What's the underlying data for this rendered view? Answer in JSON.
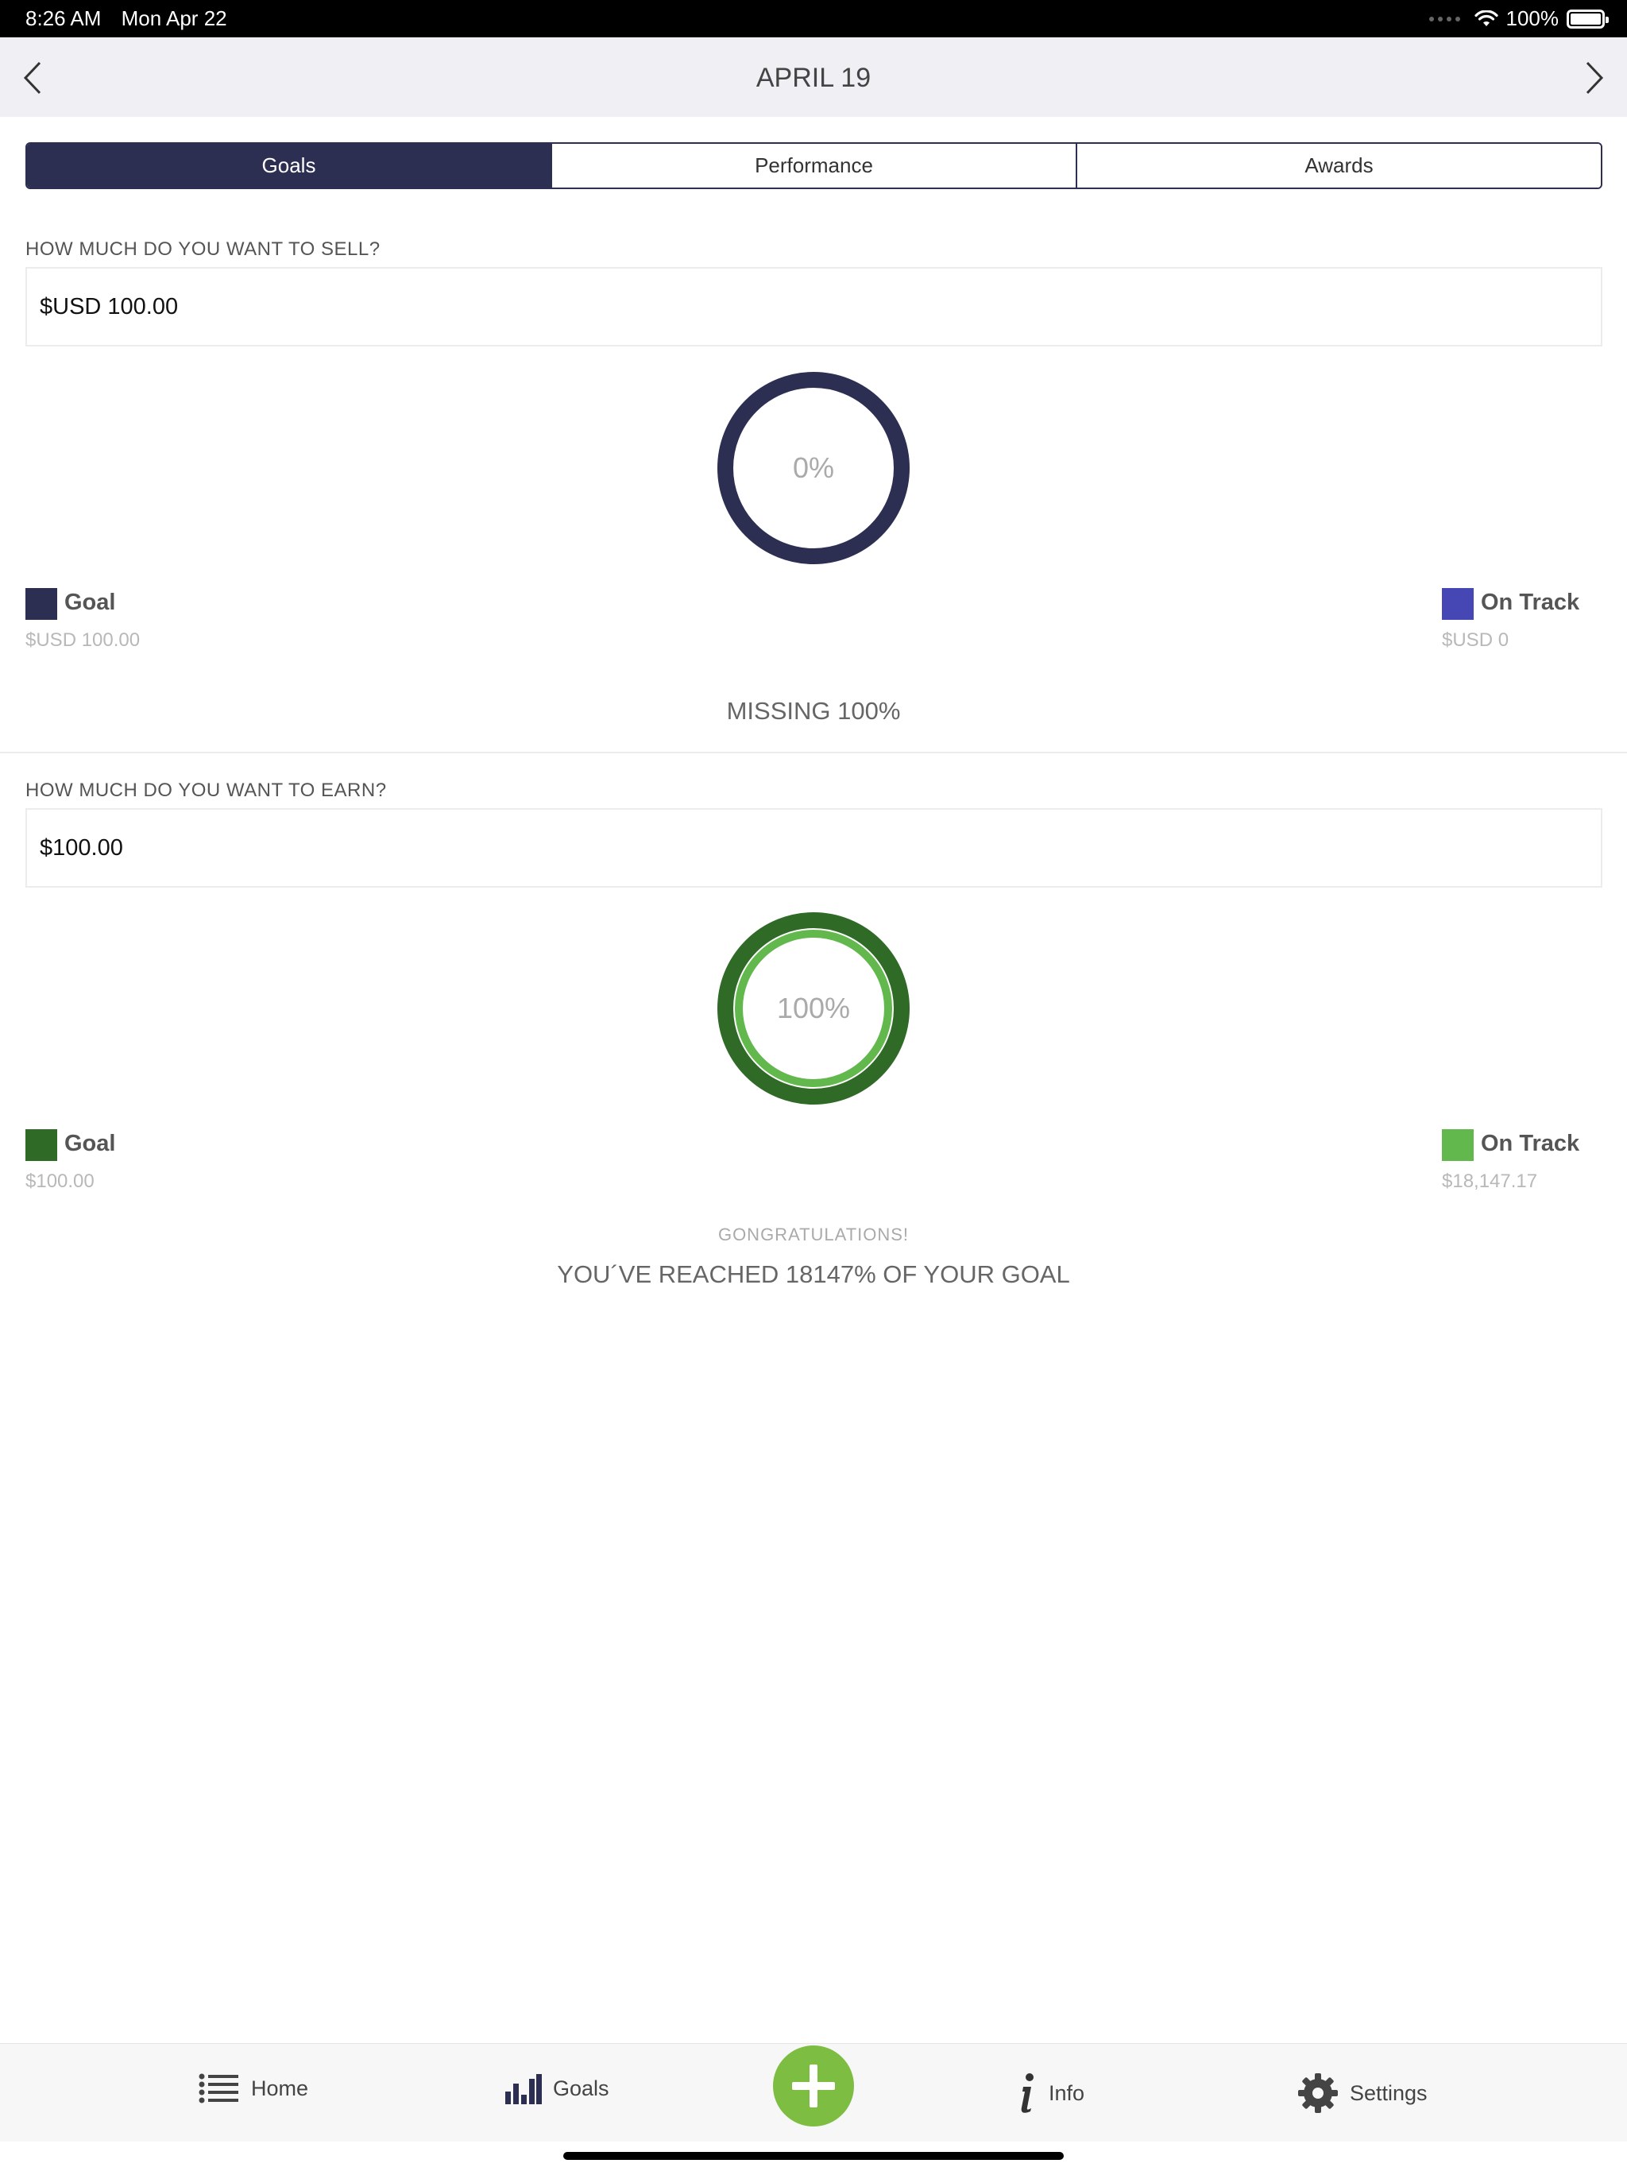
{
  "status_bar": {
    "time": "8:26 AM",
    "date": "Mon Apr 22",
    "battery": "100%"
  },
  "nav": {
    "title": "APRIL 19",
    "back_icon": "chevron-left-icon",
    "forward_icon": "chevron-right-icon"
  },
  "tabs": [
    {
      "label": "Goals",
      "active": true
    },
    {
      "label": "Performance",
      "active": false
    },
    {
      "label": "Awards",
      "active": false
    }
  ],
  "sell": {
    "question": "HOW MUCH DO YOU WANT TO SELL?",
    "value": "$USD 100.00",
    "progress_label": "0%",
    "progress_fraction": 0,
    "ring_color": "#2c2e52",
    "goal": {
      "label": "Goal",
      "value": "$USD 100.00",
      "color": "#2c2e52"
    },
    "on_track": {
      "label": "On Track",
      "value": "$USD 0",
      "color": "#4646b4"
    },
    "status": "MISSING 100%"
  },
  "earn": {
    "question": "HOW MUCH DO YOU WANT TO EARN?",
    "value": "$100.00",
    "progress_label": "100%",
    "progress_fraction": 1,
    "ring_color": "#2f6a27",
    "progress_color": "#62b84c",
    "goal": {
      "label": "Goal",
      "value": "$100.00",
      "color": "#2f6a27"
    },
    "on_track": {
      "label": "On Track",
      "value": "$18,147.17",
      "color": "#62b84c"
    },
    "congrats": "GONGRATULATIONS!",
    "status": "YOU´VE REACHED 18147% OF YOUR GOAL"
  },
  "tab_bar": {
    "home": "Home",
    "goals": "Goals",
    "info": "Info",
    "settings": "Settings",
    "add_color": "#7cbd42"
  }
}
